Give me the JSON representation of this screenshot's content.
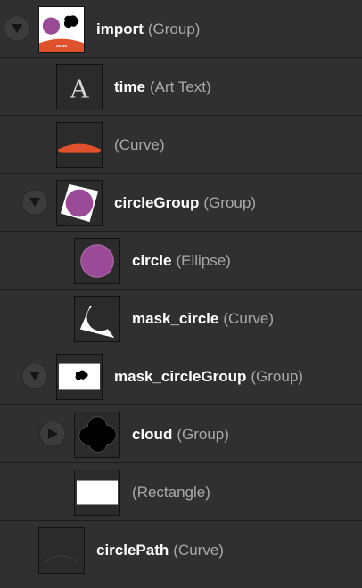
{
  "layers": [
    {
      "name": "import",
      "type": "(Group)",
      "disclosure": "expanded",
      "thumbnail": "import-thumbnail"
    },
    {
      "name": "time",
      "type": "(Art Text)",
      "thumbnail": "art-text-thumbnail",
      "thumb_glyph": "A"
    },
    {
      "name": "",
      "type": "(Curve)",
      "thumbnail": "orange-curve-thumbnail"
    },
    {
      "name": "circleGroup",
      "type": "(Group)",
      "disclosure": "expanded",
      "thumbnail": "circle-group-thumbnail"
    },
    {
      "name": "circle",
      "type": "(Ellipse)",
      "thumbnail": "purple-circle-thumbnail"
    },
    {
      "name": "mask_circle",
      "type": "(Curve)",
      "thumbnail": "mask-circle-thumbnail"
    },
    {
      "name": "mask_circleGroup",
      "type": "(Group)",
      "disclosure": "expanded",
      "thumbnail": "mask-circle-group-thumbnail"
    },
    {
      "name": "cloud",
      "type": "(Group)",
      "disclosure": "collapsed",
      "thumbnail": "cloud-thumbnail"
    },
    {
      "name": "",
      "type": "(Rectangle)",
      "thumbnail": "white-rectangle-thumbnail"
    },
    {
      "name": "circlePath",
      "type": "(Curve)",
      "thumbnail": "circle-path-thumbnail"
    }
  ],
  "thumbnail_text": {
    "import_time": "00:00"
  },
  "colors": {
    "panel_background": "#303030",
    "row_divider": "#1d1d1d",
    "name_text": "#ffffff",
    "type_text": "#a9a9a9",
    "accent_orange": "#e0522b",
    "accent_purple": "#9a4a96"
  }
}
